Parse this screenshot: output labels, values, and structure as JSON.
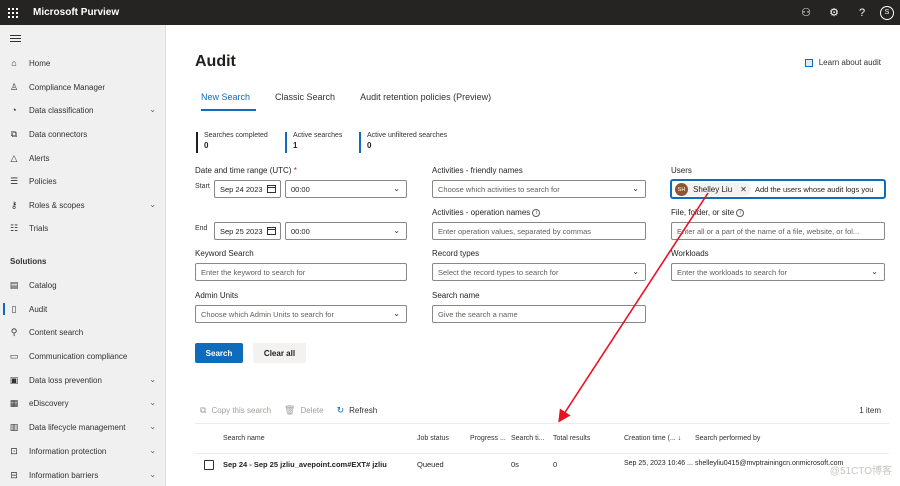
{
  "app": {
    "title": "Microsoft Purview",
    "user_initial": "S"
  },
  "sidebar": {
    "items": [
      {
        "label": "Home",
        "icon": "home-icon"
      },
      {
        "label": "Compliance Manager",
        "icon": "trophy-icon"
      },
      {
        "label": "Data classification",
        "icon": "chart-icon",
        "expandable": true
      },
      {
        "label": "Data connectors",
        "icon": "connector-icon"
      },
      {
        "label": "Alerts",
        "icon": "alert-icon"
      },
      {
        "label": "Policies",
        "icon": "policies-icon"
      },
      {
        "label": "Roles & scopes",
        "icon": "key-icon",
        "expandable": true
      },
      {
        "label": "Trials",
        "icon": "trials-icon"
      }
    ],
    "section_label": "Solutions",
    "solutions": [
      {
        "label": "Catalog",
        "icon": "catalog-icon"
      },
      {
        "label": "Audit",
        "icon": "audit-icon",
        "active": true
      },
      {
        "label": "Content search",
        "icon": "search-icon"
      },
      {
        "label": "Communication compliance",
        "icon": "chat-icon"
      },
      {
        "label": "Data loss prevention",
        "icon": "dlp-icon",
        "expandable": true
      },
      {
        "label": "eDiscovery",
        "icon": "ediscovery-icon",
        "expandable": true
      },
      {
        "label": "Data lifecycle management",
        "icon": "lifecycle-icon",
        "expandable": true
      },
      {
        "label": "Information protection",
        "icon": "lock-icon",
        "expandable": true
      },
      {
        "label": "Information barriers",
        "icon": "barrier-icon",
        "expandable": true
      }
    ]
  },
  "page": {
    "title": "Audit",
    "learn_link": "Learn about audit",
    "tabs": [
      {
        "label": "New Search",
        "active": true
      },
      {
        "label": "Classic Search"
      },
      {
        "label": "Audit retention policies (Preview)"
      }
    ],
    "stats": [
      {
        "label": "Searches completed",
        "value": "0",
        "color": "#201f1e"
      },
      {
        "label": "Active searches",
        "value": "1",
        "color": "#0f6cbd"
      },
      {
        "label": "Active unfiltered searches",
        "value": "0",
        "color": "#0f6cbd"
      }
    ]
  },
  "form": {
    "date_label": "Date and time range (UTC)",
    "required_mark": "*",
    "start_label": "Start",
    "start_date": "Sep 24 2023",
    "start_time": "00:00",
    "end_label": "End",
    "end_date": "Sep 25 2023",
    "end_time": "00:00",
    "activities_friendly_label": "Activities - friendly names",
    "activities_friendly_placeholder": "Choose which activities to search for",
    "activities_operation_label": "Activities - operation names",
    "activities_operation_placeholder": "Enter operation values, separated by commas",
    "users_label": "Users",
    "user_chip_initials": "SH",
    "user_chip_name": "Shelley Liu",
    "users_placeholder": "Add the users whose audit logs you",
    "file_label": "File, folder, or site",
    "file_placeholder": "Enter all or a part of the name of a file, website, or fol...",
    "keyword_label": "Keyword Search",
    "keyword_placeholder": "Enter the keyword to search for",
    "record_types_label": "Record types",
    "record_types_placeholder": "Select the record types to search for",
    "workloads_label": "Workloads",
    "workloads_placeholder": "Enter the workloads to search for",
    "admin_units_label": "Admin Units",
    "admin_units_placeholder": "Choose which Admin Units to search for",
    "search_name_label": "Search name",
    "search_name_placeholder": "Give the search a name",
    "search_button": "Search",
    "clear_button": "Clear all"
  },
  "results": {
    "toolbar": {
      "copy": "Copy this search",
      "delete": "Delete",
      "refresh": "Refresh"
    },
    "count": "1 item",
    "columns": [
      "Search name",
      "Job status",
      "Progress ...",
      "Search ti...",
      "Total results",
      "Creation time (...",
      "Search performed by"
    ],
    "sort_indicator": "↓",
    "rows": [
      {
        "name": "Sep 24 - Sep 25 jzliu_avepoint.com#EXT# jzliu",
        "status": "Queued",
        "progress": "",
        "search_time": "0s",
        "total": "0",
        "created": "Sep 25, 2023 10:46 ...",
        "by": "shelleyliu0415@mvptrainingcn.onmicrosoft.com"
      }
    ]
  },
  "watermark": "@51CTO博客"
}
